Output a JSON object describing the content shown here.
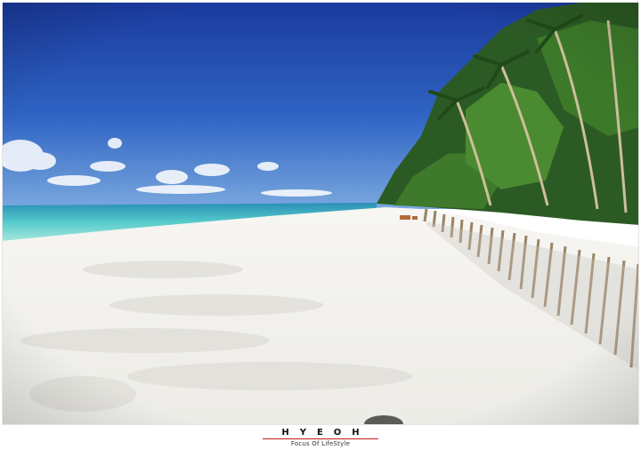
{
  "photo": {
    "subject": "beach-scene",
    "colors": {
      "sky_top": "#1a3fa8",
      "sky_bottom": "#5d93d8",
      "sea": "#48c4c8",
      "sand": "#f4f2ee",
      "palm": "#2c5a24",
      "fence": "#a08a6e"
    }
  },
  "caption": {
    "brand": "HYEOH",
    "tagline": "Focus Of LifeStyle",
    "accent_color": "#c41818"
  }
}
